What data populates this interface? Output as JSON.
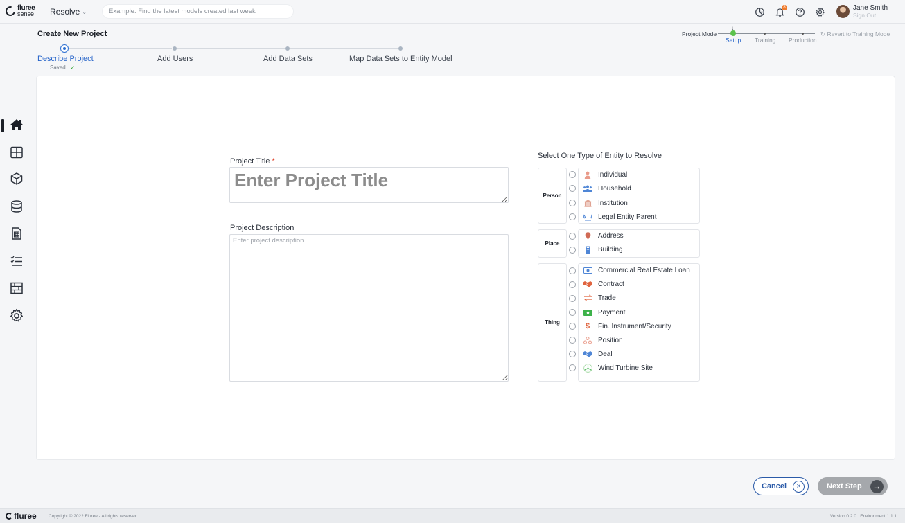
{
  "header": {
    "logo": {
      "line1": "fluree",
      "line2": "sense"
    },
    "app_switcher": "Resolve",
    "search_placeholder": "Example: Find the latest models created last week",
    "notification_count": "8",
    "user": {
      "name": "Jane Smith",
      "sign_out": "Sign Out"
    }
  },
  "sidebar": {
    "items": [
      {
        "name": "home",
        "active": true
      },
      {
        "name": "dashboard-grid",
        "active": false
      },
      {
        "name": "models-cube",
        "active": false
      },
      {
        "name": "database",
        "active": false
      },
      {
        "name": "reports",
        "active": false
      },
      {
        "name": "task-list",
        "active": false
      },
      {
        "name": "data-tables",
        "active": false
      },
      {
        "name": "settings",
        "active": false
      }
    ]
  },
  "project": {
    "title": "Create New Project",
    "steps": [
      {
        "label": "Describe Project",
        "active": true,
        "status": "Saved..."
      },
      {
        "label": "Add Users",
        "active": false
      },
      {
        "label": "Add Data Sets",
        "active": false
      },
      {
        "label": "Map Data Sets to Entity Model",
        "active": false
      }
    ],
    "mode": {
      "label": "Project Mode",
      "options": [
        "Setup",
        "Training",
        "Production"
      ],
      "current": "Setup",
      "revert": "Revert to Training Mode"
    }
  },
  "form": {
    "title_label": "Project Title",
    "title_required_mark": "*",
    "title_placeholder": "Enter Project Title",
    "description_label": "Project Description",
    "description_placeholder": "Enter project description."
  },
  "entities": {
    "heading": "Select One Type of Entity to Resolve",
    "groups": [
      {
        "name": "Person",
        "items": [
          {
            "label": "Individual",
            "icon": "person-icon"
          },
          {
            "label": "Household",
            "icon": "household-icon"
          },
          {
            "label": "Institution",
            "icon": "institution-icon"
          },
          {
            "label": "Legal Entity Parent",
            "icon": "scales-icon"
          }
        ]
      },
      {
        "name": "Place",
        "items": [
          {
            "label": "Address",
            "icon": "map-pin-icon"
          },
          {
            "label": "Building",
            "icon": "building-icon"
          }
        ]
      },
      {
        "name": "Thing",
        "items": [
          {
            "label": "Commercial Real Estate Loan",
            "icon": "loan-icon"
          },
          {
            "label": "Contract",
            "icon": "handshake-icon"
          },
          {
            "label": "Trade",
            "icon": "swap-icon"
          },
          {
            "label": "Payment",
            "icon": "payment-icon"
          },
          {
            "label": "Fin. Instrument/Security",
            "icon": "dollar-icon"
          },
          {
            "label": "Position",
            "icon": "position-icon"
          },
          {
            "label": "Deal",
            "icon": "deal-icon"
          },
          {
            "label": "Wind Turbine Site",
            "icon": "wind-turbine-icon"
          }
        ]
      }
    ]
  },
  "actions": {
    "cancel": "Cancel",
    "next": "Next Step"
  },
  "footer": {
    "logo": "fluree",
    "copyright": "Copyright © 2022 Fluree - All rights reserved.",
    "version": "Version 0.2.0   Environment 1.1.1"
  },
  "colors": {
    "accent": "#2563c9",
    "active_mode": "#5bc24c",
    "required": "#e0442b"
  }
}
